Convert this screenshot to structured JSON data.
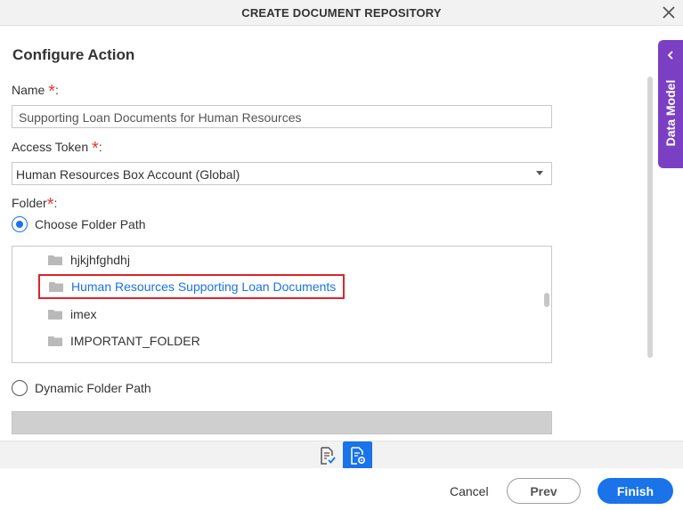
{
  "dialog": {
    "title": "CREATE DOCUMENT REPOSITORY",
    "close_icon": "close-icon"
  },
  "form": {
    "section_title": "Configure Action",
    "name": {
      "label": "Name",
      "required_mark": "*",
      "suffix": ":",
      "value": "Supporting Loan Documents for Human Resources"
    },
    "access_token": {
      "label": "Access Token",
      "required_mark": "*",
      "suffix": ":",
      "selected": "Human Resources Box Account (Global)"
    },
    "folder": {
      "label": "Folder",
      "required_mark": "*",
      "suffix": ":",
      "options": {
        "choose_path": {
          "label": "Choose Folder Path",
          "checked": true
        },
        "dynamic_path": {
          "label": "Dynamic Folder Path",
          "checked": false
        }
      },
      "tree_items": [
        {
          "label": "hjkjhfghdhj",
          "selected": false
        },
        {
          "label": "Human Resources Supporting Loan Documents",
          "selected": true
        },
        {
          "label": "imex",
          "selected": false
        },
        {
          "label": "IMPORTANT_FOLDER",
          "selected": false
        }
      ]
    }
  },
  "side_panel": {
    "label": "Data Model",
    "icon": "chevron-left-icon"
  },
  "toolbar": {
    "buttons": [
      {
        "icon": "document-check-icon",
        "active": false
      },
      {
        "icon": "document-settings-icon",
        "active": true
      }
    ]
  },
  "footer": {
    "cancel_label": "Cancel",
    "prev_label": "Prev",
    "finish_label": "Finish"
  },
  "colors": {
    "accent": "#1a73e8",
    "required": "#e53935",
    "side_panel": "#7b3fc4",
    "selection_border": "#d9262c"
  }
}
